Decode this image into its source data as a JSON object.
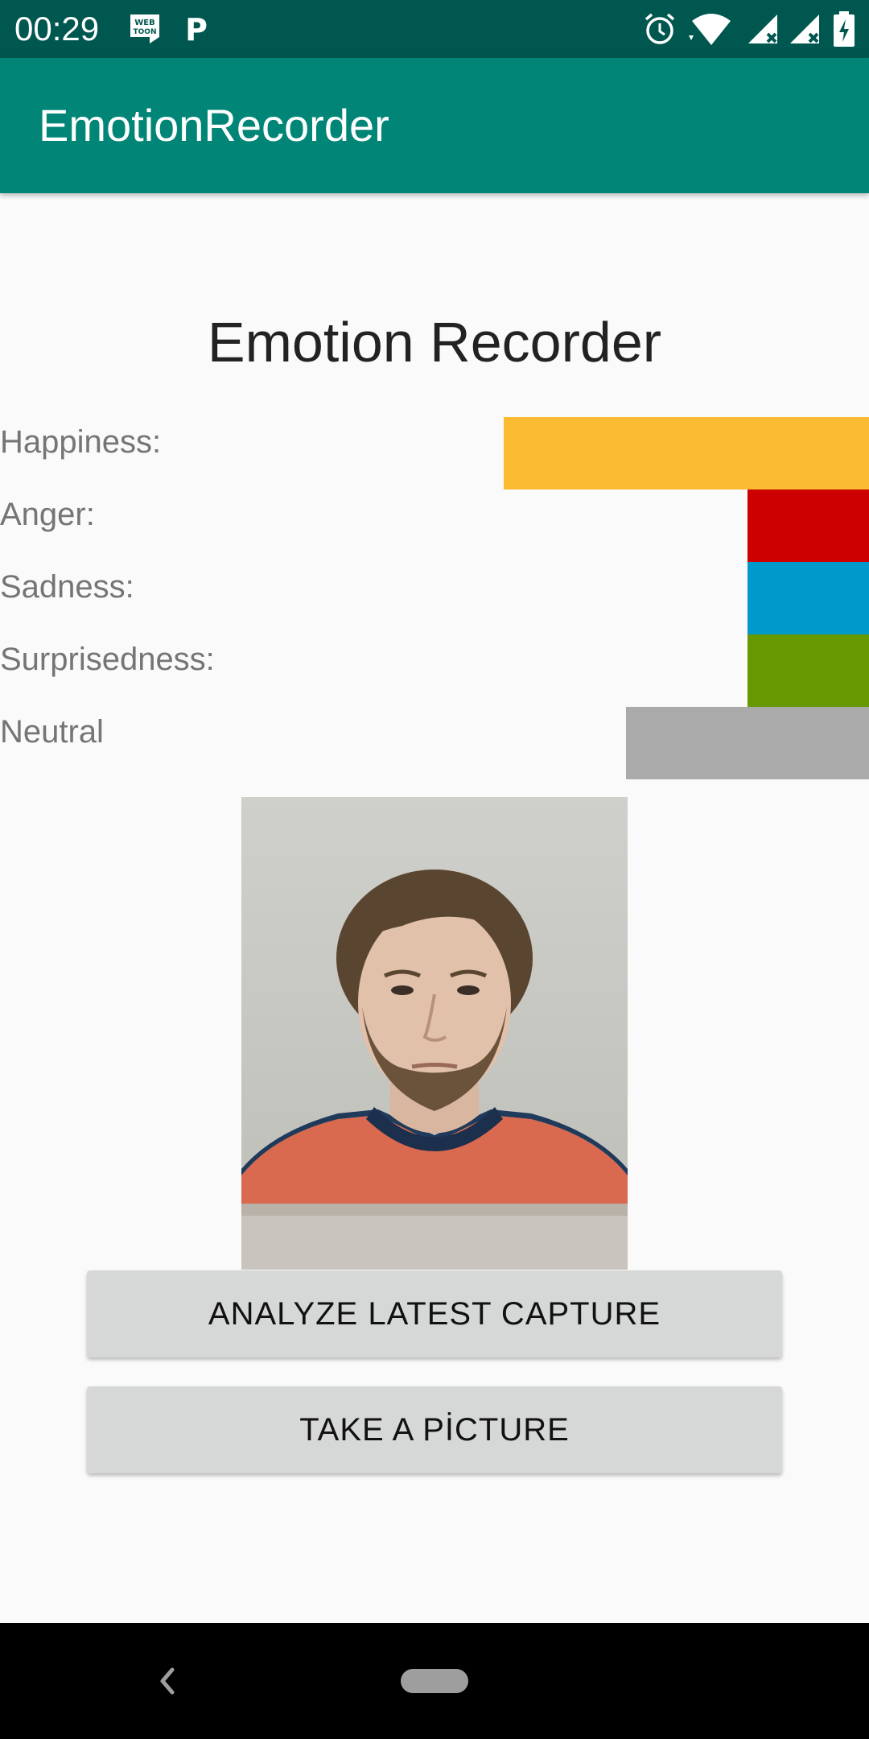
{
  "status_bar": {
    "time": "00:29",
    "left_icons": [
      "webtoon-icon",
      "parking-p-icon"
    ],
    "right_icons": [
      "alarm-icon",
      "wifi-icon",
      "signal-no-data-icon",
      "signal-no-data-icon",
      "battery-icon"
    ],
    "webtoon_text_top": "WEB",
    "webtoon_text_bottom": "TOON",
    "p_letter": "P"
  },
  "app_bar": {
    "title": "EmotionRecorder",
    "color": "#008577"
  },
  "main": {
    "heading": "Emotion Recorder",
    "emotions": [
      {
        "label": "Happiness:",
        "color": "#fbbc34",
        "level": 0.42
      },
      {
        "label": "Anger:",
        "color": "#cc0000",
        "level": 0.14
      },
      {
        "label": "Sadness:",
        "color": "#0099cc",
        "level": 0.14
      },
      {
        "label": "Surprisedness:",
        "color": "#669900",
        "level": 0.14
      },
      {
        "label": "Neutral",
        "color": "#aaaaaa",
        "level": 0.28
      }
    ],
    "photo_icon": "captured-face-photo"
  },
  "buttons": {
    "analyze": "ANALYZE LATEST CAPTURE",
    "take_picture": "TAKE A PİCTURE"
  },
  "nav_bar": {
    "icons": [
      "back-icon",
      "home-pill-icon"
    ]
  }
}
